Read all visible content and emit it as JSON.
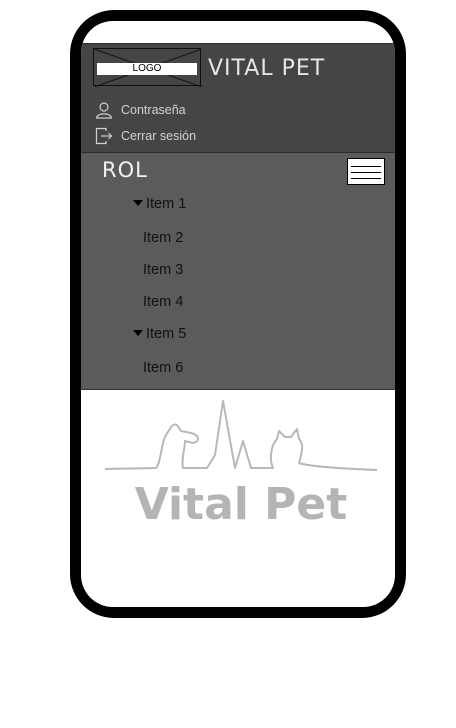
{
  "header": {
    "logo_label": "LOGO",
    "app_title": "VITAL PET",
    "links": [
      {
        "label": "Contraseña",
        "icon": "user-icon"
      },
      {
        "label": "Cerrar sesión",
        "icon": "logout-icon"
      }
    ]
  },
  "role_panel": {
    "title": "ROL",
    "items": [
      {
        "label": "Item 1",
        "expandable": true
      },
      {
        "label": "Item 2",
        "expandable": false
      },
      {
        "label": "Item 3",
        "expandable": false
      },
      {
        "label": "Item 4",
        "expandable": false
      },
      {
        "label": "Item 5",
        "expandable": true
      },
      {
        "label": "Item 6",
        "expandable": false
      }
    ]
  },
  "brand": {
    "name": "Vital Pet"
  },
  "colors": {
    "header_bg": "#454545",
    "panel_bg": "#5b5b5b",
    "frame": "#000000",
    "brand_gray": "#b4b4b4"
  }
}
